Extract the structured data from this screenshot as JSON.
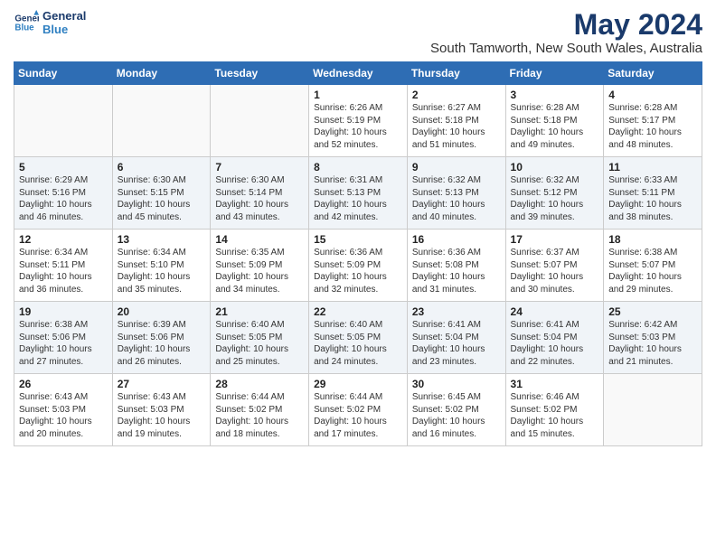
{
  "logo": {
    "line1": "General",
    "line2": "Blue"
  },
  "title": "May 2024",
  "subtitle": "South Tamworth, New South Wales, Australia",
  "weekdays": [
    "Sunday",
    "Monday",
    "Tuesday",
    "Wednesday",
    "Thursday",
    "Friday",
    "Saturday"
  ],
  "weeks": [
    [
      {
        "day": "",
        "content": ""
      },
      {
        "day": "",
        "content": ""
      },
      {
        "day": "",
        "content": ""
      },
      {
        "day": "1",
        "content": "Sunrise: 6:26 AM\nSunset: 5:19 PM\nDaylight: 10 hours and 52 minutes."
      },
      {
        "day": "2",
        "content": "Sunrise: 6:27 AM\nSunset: 5:18 PM\nDaylight: 10 hours and 51 minutes."
      },
      {
        "day": "3",
        "content": "Sunrise: 6:28 AM\nSunset: 5:18 PM\nDaylight: 10 hours and 49 minutes."
      },
      {
        "day": "4",
        "content": "Sunrise: 6:28 AM\nSunset: 5:17 PM\nDaylight: 10 hours and 48 minutes."
      }
    ],
    [
      {
        "day": "5",
        "content": "Sunrise: 6:29 AM\nSunset: 5:16 PM\nDaylight: 10 hours and 46 minutes."
      },
      {
        "day": "6",
        "content": "Sunrise: 6:30 AM\nSunset: 5:15 PM\nDaylight: 10 hours and 45 minutes."
      },
      {
        "day": "7",
        "content": "Sunrise: 6:30 AM\nSunset: 5:14 PM\nDaylight: 10 hours and 43 minutes."
      },
      {
        "day": "8",
        "content": "Sunrise: 6:31 AM\nSunset: 5:13 PM\nDaylight: 10 hours and 42 minutes."
      },
      {
        "day": "9",
        "content": "Sunrise: 6:32 AM\nSunset: 5:13 PM\nDaylight: 10 hours and 40 minutes."
      },
      {
        "day": "10",
        "content": "Sunrise: 6:32 AM\nSunset: 5:12 PM\nDaylight: 10 hours and 39 minutes."
      },
      {
        "day": "11",
        "content": "Sunrise: 6:33 AM\nSunset: 5:11 PM\nDaylight: 10 hours and 38 minutes."
      }
    ],
    [
      {
        "day": "12",
        "content": "Sunrise: 6:34 AM\nSunset: 5:11 PM\nDaylight: 10 hours and 36 minutes."
      },
      {
        "day": "13",
        "content": "Sunrise: 6:34 AM\nSunset: 5:10 PM\nDaylight: 10 hours and 35 minutes."
      },
      {
        "day": "14",
        "content": "Sunrise: 6:35 AM\nSunset: 5:09 PM\nDaylight: 10 hours and 34 minutes."
      },
      {
        "day": "15",
        "content": "Sunrise: 6:36 AM\nSunset: 5:09 PM\nDaylight: 10 hours and 32 minutes."
      },
      {
        "day": "16",
        "content": "Sunrise: 6:36 AM\nSunset: 5:08 PM\nDaylight: 10 hours and 31 minutes."
      },
      {
        "day": "17",
        "content": "Sunrise: 6:37 AM\nSunset: 5:07 PM\nDaylight: 10 hours and 30 minutes."
      },
      {
        "day": "18",
        "content": "Sunrise: 6:38 AM\nSunset: 5:07 PM\nDaylight: 10 hours and 29 minutes."
      }
    ],
    [
      {
        "day": "19",
        "content": "Sunrise: 6:38 AM\nSunset: 5:06 PM\nDaylight: 10 hours and 27 minutes."
      },
      {
        "day": "20",
        "content": "Sunrise: 6:39 AM\nSunset: 5:06 PM\nDaylight: 10 hours and 26 minutes."
      },
      {
        "day": "21",
        "content": "Sunrise: 6:40 AM\nSunset: 5:05 PM\nDaylight: 10 hours and 25 minutes."
      },
      {
        "day": "22",
        "content": "Sunrise: 6:40 AM\nSunset: 5:05 PM\nDaylight: 10 hours and 24 minutes."
      },
      {
        "day": "23",
        "content": "Sunrise: 6:41 AM\nSunset: 5:04 PM\nDaylight: 10 hours and 23 minutes."
      },
      {
        "day": "24",
        "content": "Sunrise: 6:41 AM\nSunset: 5:04 PM\nDaylight: 10 hours and 22 minutes."
      },
      {
        "day": "25",
        "content": "Sunrise: 6:42 AM\nSunset: 5:03 PM\nDaylight: 10 hours and 21 minutes."
      }
    ],
    [
      {
        "day": "26",
        "content": "Sunrise: 6:43 AM\nSunset: 5:03 PM\nDaylight: 10 hours and 20 minutes."
      },
      {
        "day": "27",
        "content": "Sunrise: 6:43 AM\nSunset: 5:03 PM\nDaylight: 10 hours and 19 minutes."
      },
      {
        "day": "28",
        "content": "Sunrise: 6:44 AM\nSunset: 5:02 PM\nDaylight: 10 hours and 18 minutes."
      },
      {
        "day": "29",
        "content": "Sunrise: 6:44 AM\nSunset: 5:02 PM\nDaylight: 10 hours and 17 minutes."
      },
      {
        "day": "30",
        "content": "Sunrise: 6:45 AM\nSunset: 5:02 PM\nDaylight: 10 hours and 16 minutes."
      },
      {
        "day": "31",
        "content": "Sunrise: 6:46 AM\nSunset: 5:02 PM\nDaylight: 10 hours and 15 minutes."
      },
      {
        "day": "",
        "content": ""
      }
    ]
  ]
}
